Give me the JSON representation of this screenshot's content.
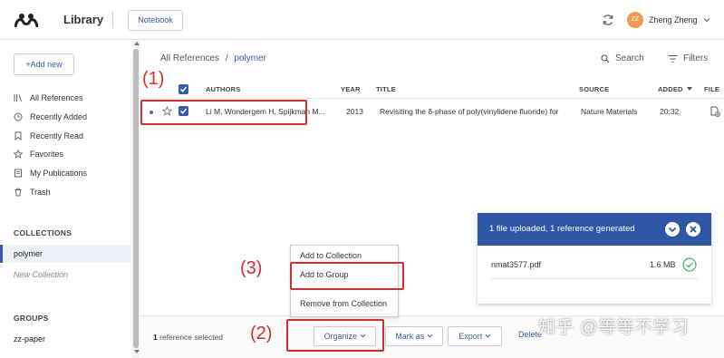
{
  "header": {
    "app_title": "Library",
    "notebook_button": "Notebook",
    "user_initials": "ZZ",
    "user_name": "Zheng Zheng"
  },
  "sidebar": {
    "add_new": "+Add new",
    "items": [
      {
        "label": "All References",
        "icon": "library-icon"
      },
      {
        "label": "Recently Added",
        "icon": "clock-icon"
      },
      {
        "label": "Recently Read",
        "icon": "bookmark-icon"
      },
      {
        "label": "Favorites",
        "icon": "star-icon"
      },
      {
        "label": "My Publications",
        "icon": "publication-icon"
      },
      {
        "label": "Trash",
        "icon": "trash-icon"
      }
    ],
    "collections_heading": "COLLECTIONS",
    "collections": [
      "polymer"
    ],
    "new_collection": "New Collection",
    "groups_heading": "GROUPS",
    "groups": [
      "zz-paper"
    ]
  },
  "main": {
    "breadcrumb_root": "All References",
    "breadcrumb_sep": "/",
    "breadcrumb_current": "polymer",
    "search_label": "Search",
    "filters_label": "Filters",
    "columns": [
      "AUTHORS",
      "YEAR",
      "TITLE",
      "SOURCE",
      "ADDED",
      "FILE"
    ],
    "rows": [
      {
        "authors": "Li M, Wondergem H, Spijkman M...",
        "year": "2013",
        "title": "Revisiting the δ-phase of poly(vinylidene fluoride) for",
        "source": "Nature Materials",
        "added": "20:32"
      }
    ]
  },
  "upload": {
    "header": "1 file uploaded, 1 reference generated",
    "file_name": "nmat3577.pdf",
    "file_size": "1.6 MB"
  },
  "menu": {
    "items": [
      "Add to Collection",
      "Add to Group",
      "Remove from Collection"
    ]
  },
  "footer": {
    "count": "1",
    "count_suffix": "reference selected",
    "organize": "Organize",
    "mark_as": "Mark as",
    "export": "Export",
    "delete": "Delete"
  },
  "annotations": {
    "label_1": "(1)",
    "label_2": "(2)",
    "label_3": "(3)",
    "color": "#d03030"
  },
  "watermark": "知乎 @等等不学习",
  "colors": {
    "accent": "#3a59a8",
    "upload_header": "#2d57a5",
    "avatar": "#f09b55"
  }
}
